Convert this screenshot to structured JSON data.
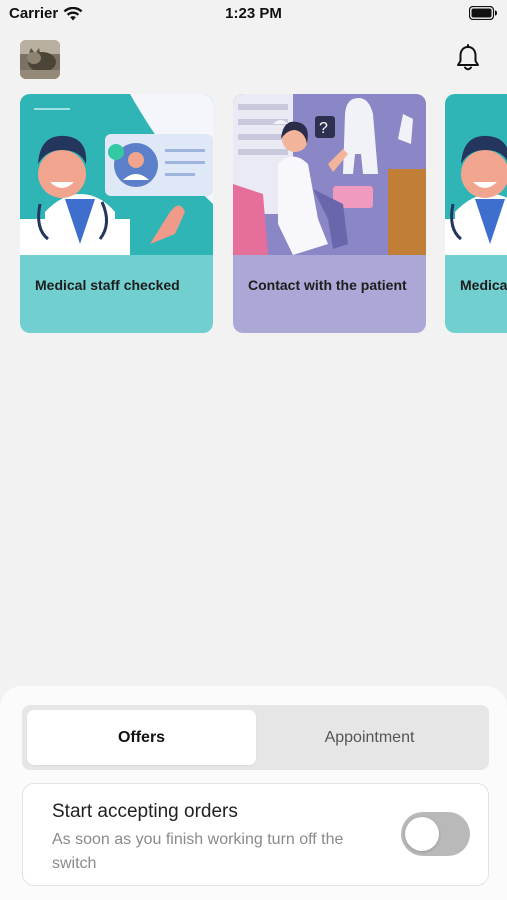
{
  "status_bar": {
    "carrier": "Carrier",
    "time": "1:23 PM"
  },
  "header": {
    "avatar_icon": "user-photo-icon",
    "bell_icon": "bell-icon"
  },
  "cards": [
    {
      "label": "Medical staff checked",
      "color": "#72cfcf"
    },
    {
      "label": "Contact with the patient",
      "color": "#aba7d6"
    },
    {
      "label": "Medica",
      "color": "#72cfcf"
    }
  ],
  "tabs": {
    "offers": "Offers",
    "appointment": "Appointment",
    "active": "Offers"
  },
  "accepting_orders": {
    "title": "Start accepting orders",
    "description": "As soon as you finish working turn off the switch",
    "switch_on": false
  }
}
